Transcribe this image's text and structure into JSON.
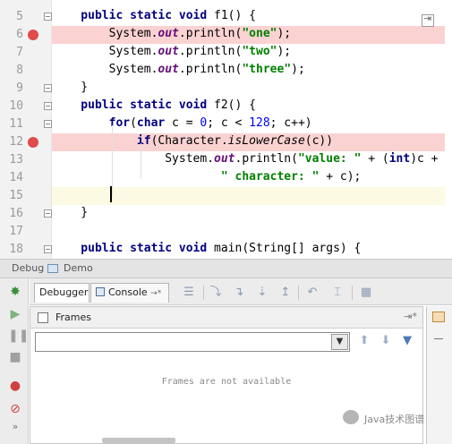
{
  "editor": {
    "lines": [
      {
        "n": "5",
        "segs": [
          [
            "kw",
            "    public static void "
          ],
          [
            "",
            "f1() {"
          ]
        ]
      },
      {
        "n": "6",
        "segs": [
          [
            "",
            "        System."
          ],
          [
            "fi",
            "out"
          ],
          [
            "",
            ".println("
          ],
          [
            "st",
            "\"one\""
          ],
          [
            "",
            ");"
          ]
        ]
      },
      {
        "n": "7",
        "segs": [
          [
            "",
            "        System."
          ],
          [
            "fi",
            "out"
          ],
          [
            "",
            ".println("
          ],
          [
            "st",
            "\"two\""
          ],
          [
            "",
            ");"
          ]
        ]
      },
      {
        "n": "8",
        "segs": [
          [
            "",
            "        System."
          ],
          [
            "fi",
            "out"
          ],
          [
            "",
            ".println("
          ],
          [
            "st",
            "\"three\""
          ],
          [
            "",
            ");"
          ]
        ]
      },
      {
        "n": "9",
        "segs": [
          [
            "",
            "    }"
          ]
        ]
      },
      {
        "n": "10",
        "segs": [
          [
            "kw",
            "    public static void "
          ],
          [
            "",
            "f2() {"
          ]
        ]
      },
      {
        "n": "11",
        "segs": [
          [
            "kw",
            "        for"
          ],
          [
            "",
            "("
          ],
          [
            "kw",
            "char"
          ],
          [
            "",
            " c = "
          ],
          [
            "num",
            "0"
          ],
          [
            "",
            "; c < "
          ],
          [
            "num",
            "128"
          ],
          [
            "",
            "; c++)"
          ]
        ]
      },
      {
        "n": "12",
        "segs": [
          [
            "kw",
            "            if"
          ],
          [
            "",
            "(Character."
          ],
          [
            "it",
            "isLowerCase"
          ],
          [
            "",
            "(c))"
          ]
        ]
      },
      {
        "n": "13",
        "segs": [
          [
            "",
            "                System."
          ],
          [
            "fi",
            "out"
          ],
          [
            "",
            ".println("
          ],
          [
            "st",
            "\"value: \""
          ],
          [
            "",
            " + ("
          ],
          [
            "kw",
            "int"
          ],
          [
            "",
            ")c +"
          ]
        ]
      },
      {
        "n": "14",
        "segs": [
          [
            "st",
            "                        \" character: \""
          ],
          [
            "",
            " + c);"
          ]
        ]
      },
      {
        "n": "15",
        "segs": [
          [
            "",
            ""
          ]
        ]
      },
      {
        "n": "16",
        "segs": [
          [
            "",
            "    }"
          ]
        ]
      },
      {
        "n": "17",
        "segs": [
          [
            "",
            ""
          ]
        ]
      },
      {
        "n": "18",
        "segs": [
          [
            "kw",
            "    public static void "
          ],
          [
            "",
            "main(String[] args) {"
          ]
        ]
      }
    ],
    "breakpoint_lines": [
      "6",
      "12"
    ],
    "caret_line": "15"
  },
  "tabbar": {
    "debug_label": "Debug",
    "demo_label": "Demo"
  },
  "toolbar": {
    "debugger_tab": "Debugger",
    "console_tab": "Console",
    "console_suffix": "→*"
  },
  "frames": {
    "title": "Frames",
    "pin": "⇥*",
    "combo_value": "",
    "empty_message": "Frames are not available"
  },
  "watermark": "Java技术图谱"
}
